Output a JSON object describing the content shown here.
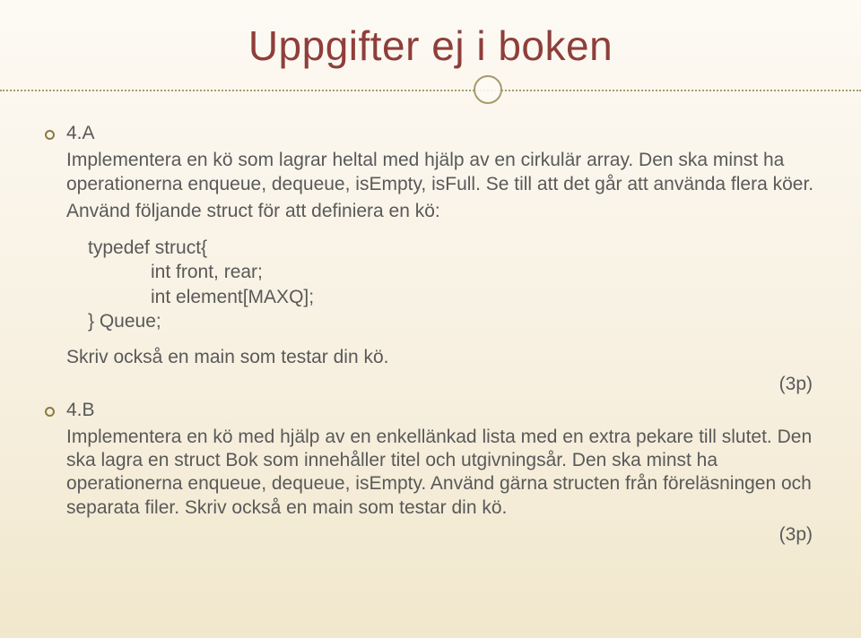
{
  "title": "Uppgifter ej i boken",
  "section4a": {
    "heading": "4.A",
    "p1": "Implementera en kö som lagrar heltal med hjälp av en cirkulär array. Den ska minst ha operationerna enqueue, dequeue, isEmpty, isFull. Se till att det går att använda flera köer.",
    "p2": "Använd följande struct för att definiera en kö:",
    "code": {
      "l1": "typedef struct{",
      "l2": "int front, rear;",
      "l3": "int element[MAXQ];",
      "l4": "} Queue;"
    },
    "p3": "Skriv också en main som testar din kö.",
    "score": "(3p)"
  },
  "section4b": {
    "heading": "4.B",
    "p1": "Implementera en kö med hjälp av en enkellänkad lista med en extra pekare till slutet. Den ska lagra en struct Bok som innehåller titel och utgivningsår. Den ska minst ha operationerna enqueue, dequeue, isEmpty. Använd gärna structen från föreläsningen och separata filer. Skriv också en main som testar din kö.",
    "score": "(3p)"
  }
}
